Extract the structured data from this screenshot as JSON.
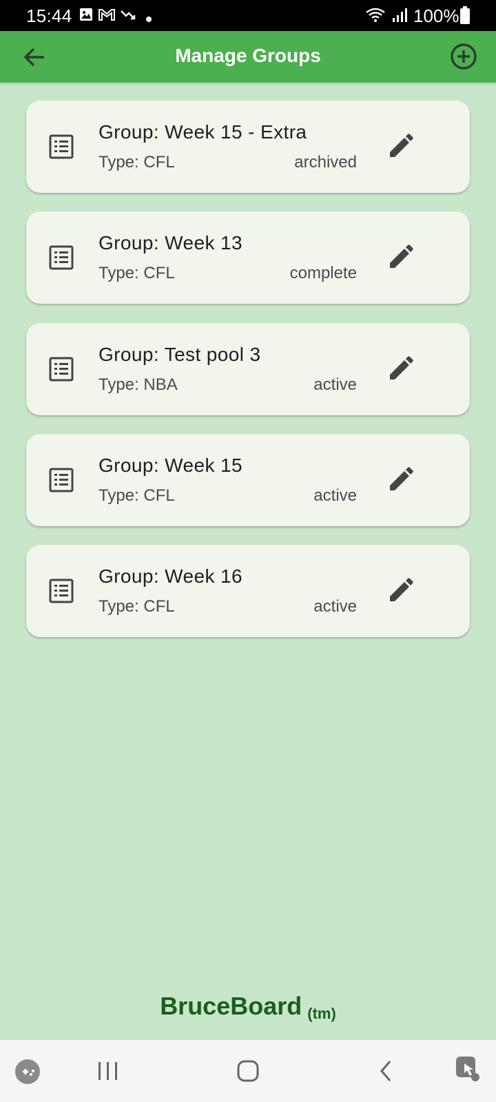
{
  "status_bar": {
    "time": "15:44",
    "battery": "100%"
  },
  "app_bar": {
    "title": "Manage Groups",
    "back_icon": "arrow-left-icon",
    "add_icon": "add-circle-icon"
  },
  "groups": [
    {
      "name": "Group: Week 15 - Extra",
      "type": "Type: CFL",
      "status": "archived"
    },
    {
      "name": "Group: Week 13",
      "type": "Type: CFL",
      "status": "complete"
    },
    {
      "name": "Group: Test pool 3",
      "type": "Type: NBA",
      "status": "active"
    },
    {
      "name": "Group: Week 15",
      "type": "Type: CFL",
      "status": "active"
    },
    {
      "name": "Group: Week 16",
      "type": "Type: CFL",
      "status": "active"
    }
  ],
  "footer": {
    "brand": "BruceBoard",
    "tm": "(tm)"
  },
  "colors": {
    "app_bar": "#4caf50",
    "background": "#c8e6c9",
    "card": "#f1f5ec",
    "brand_text": "#1b5e20",
    "icon": "#444444"
  }
}
